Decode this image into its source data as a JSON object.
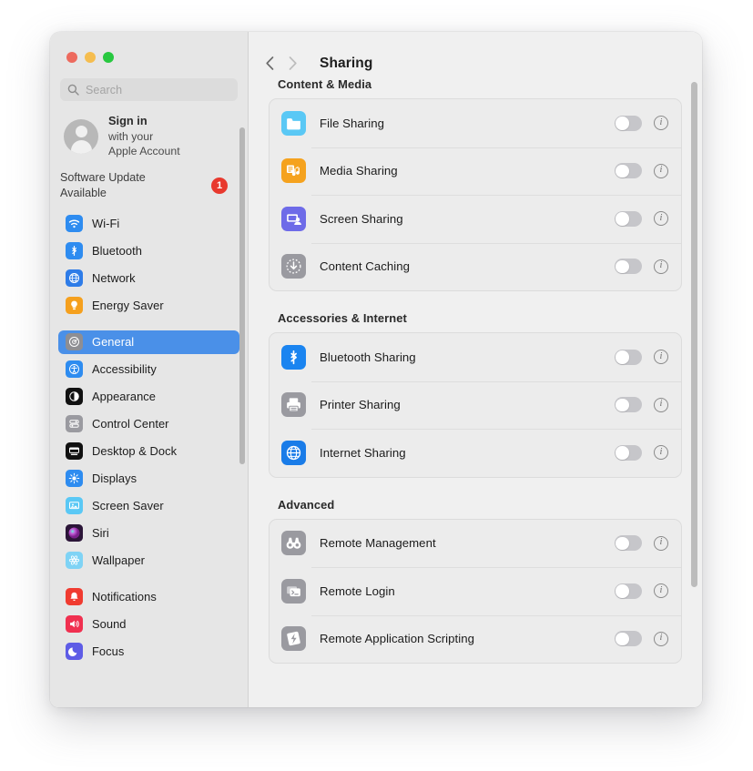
{
  "window": {
    "traffic_lights": [
      {
        "name": "close",
        "color": "#ED6A5E"
      },
      {
        "name": "minimize",
        "color": "#F5BD4F"
      },
      {
        "name": "zoom",
        "color": "#28C840"
      }
    ]
  },
  "sidebar": {
    "search": {
      "placeholder": "Search"
    },
    "account": {
      "title": "Sign in",
      "line1": "with your",
      "line2": "Apple Account"
    },
    "software_update": {
      "label": "Software Update Available",
      "badge": "1"
    },
    "groups": [
      {
        "items": [
          {
            "label": "Wi-Fi",
            "icon": "wifi-icon",
            "color": "#2E8CF0",
            "selected": false
          },
          {
            "label": "Bluetooth",
            "icon": "bluetooth-icon",
            "color": "#2E8CF0",
            "selected": false
          },
          {
            "label": "Network",
            "icon": "network-globe-icon",
            "color": "#2E7CE8",
            "selected": false
          },
          {
            "label": "Energy Saver",
            "icon": "lightbulb-icon",
            "color": "#F5A01E",
            "selected": false
          }
        ]
      },
      {
        "items": [
          {
            "label": "General",
            "icon": "gear-icon",
            "color": "#8E8E93",
            "selected": true
          },
          {
            "label": "Accessibility",
            "icon": "accessibility-icon",
            "color": "#2E8CF0",
            "selected": false
          },
          {
            "label": "Appearance",
            "icon": "appearance-icon",
            "color": "#111111",
            "selected": false
          },
          {
            "label": "Control Center",
            "icon": "control-center-icon",
            "color": "#9A9AA0",
            "selected": false
          },
          {
            "label": "Desktop & Dock",
            "icon": "desktop-dock-icon",
            "color": "#111111",
            "selected": false
          },
          {
            "label": "Displays",
            "icon": "displays-icon",
            "color": "#2E8CF0",
            "selected": false
          },
          {
            "label": "Screen Saver",
            "icon": "screen-saver-icon",
            "color": "#5AC8F5",
            "selected": false
          },
          {
            "label": "Siri",
            "icon": "siri-icon",
            "color": "#2B1538",
            "selected": false
          },
          {
            "label": "Wallpaper",
            "icon": "wallpaper-icon",
            "color": "#7FD3F5",
            "selected": false
          }
        ]
      },
      {
        "items": [
          {
            "label": "Notifications",
            "icon": "notifications-bell-icon",
            "color": "#F03B30",
            "selected": false
          },
          {
            "label": "Sound",
            "icon": "sound-speaker-icon",
            "color": "#F03050",
            "selected": false
          },
          {
            "label": "Focus",
            "icon": "focus-moon-icon",
            "color": "#5E5CE6",
            "selected": false
          }
        ]
      }
    ]
  },
  "main": {
    "toolbar": {
      "back_icon": "chevron-left-icon",
      "forward_icon": "chevron-right-icon",
      "title": "Sharing"
    },
    "sections": [
      {
        "title": "Content & Media",
        "rows": [
          {
            "label": "File Sharing",
            "icon": "folder-icon",
            "color": "#5AC8F5",
            "toggle": "off",
            "info": "i"
          },
          {
            "label": "Media Sharing",
            "icon": "media-note-icon",
            "color": "#F5A21E",
            "toggle": "off",
            "info": "i"
          },
          {
            "label": "Screen Sharing",
            "icon": "screen-person-icon",
            "color": "#6E6BE8",
            "toggle": "off",
            "info": "i"
          },
          {
            "label": "Content Caching",
            "icon": "download-arrow-icon",
            "color": "#9A9AA0",
            "toggle": "off",
            "info": "i"
          }
        ]
      },
      {
        "title": "Accessories & Internet",
        "rows": [
          {
            "label": "Bluetooth Sharing",
            "icon": "bluetooth-icon",
            "color": "#1A84F0",
            "toggle": "off",
            "info": "i"
          },
          {
            "label": "Printer Sharing",
            "icon": "printer-icon",
            "color": "#9A9AA0",
            "toggle": "off",
            "info": "i"
          },
          {
            "label": "Internet Sharing",
            "icon": "globe-icon",
            "color": "#1A7CE8",
            "toggle": "off",
            "info": "i"
          }
        ]
      },
      {
        "title": "Advanced",
        "rows": [
          {
            "label": "Remote Management",
            "icon": "binoculars-icon",
            "color": "#9A9AA0",
            "toggle": "off",
            "info": "i"
          },
          {
            "label": "Remote Login",
            "icon": "terminal-icon",
            "color": "#9A9AA0",
            "toggle": "off",
            "info": "i"
          },
          {
            "label": "Remote Application Scripting",
            "icon": "script-bolt-icon",
            "color": "#9A9AA0",
            "toggle": "off",
            "info": "i"
          }
        ]
      }
    ]
  }
}
